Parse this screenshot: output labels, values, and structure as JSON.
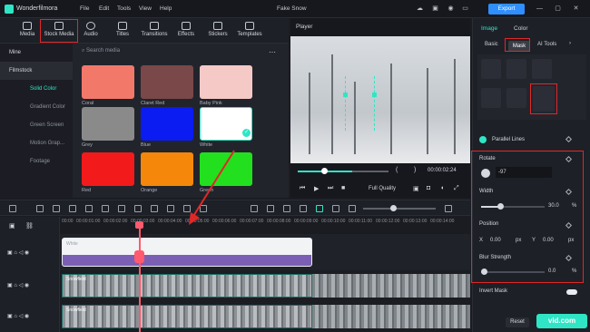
{
  "app": {
    "name": "Wonderfilmora",
    "project": "Fake Snow",
    "menu": [
      "File",
      "Edit",
      "Tools",
      "View",
      "Help"
    ],
    "export": "Export"
  },
  "media_tabs": [
    "Media",
    "Stock Media",
    "Audio",
    "Titles",
    "Transitions",
    "Effects",
    "Stickers",
    "Templates"
  ],
  "sidebar": {
    "items": [
      "Mine",
      "Filmstock",
      "Solid Color",
      "Gradient Color",
      "Green Screen",
      "Motion Grap...",
      "Footage"
    ]
  },
  "search": {
    "placeholder": "Search media"
  },
  "tiles": [
    {
      "label": "Coral",
      "color": "#f2796a"
    },
    {
      "label": "Claret Red",
      "color": "#7a4848"
    },
    {
      "label": "Baby Pink",
      "color": "#f5c9c6"
    },
    {
      "label": "Grey",
      "color": "#8a8a8a"
    },
    {
      "label": "Blue",
      "color": "#0a1cf2"
    },
    {
      "label": "White",
      "color": "#ffffff"
    },
    {
      "label": "Red",
      "color": "#f21a1a"
    },
    {
      "label": "Orange",
      "color": "#f5870a"
    },
    {
      "label": "Green",
      "color": "#22e01e"
    }
  ],
  "player": {
    "title": "Player",
    "timecode": "00:00:02:24",
    "quality": "Full Quality",
    "progress": 0.6
  },
  "right": {
    "tabs": [
      "Image",
      "Color"
    ],
    "subtabs": [
      "Basic",
      "Mask",
      "AI Tools"
    ],
    "mask_label": "Parallel Lines",
    "rotate": {
      "label": "Rotate",
      "value": "-97"
    },
    "width": {
      "label": "Width",
      "value": "30.0",
      "unit": "%",
      "level": 0.3
    },
    "position": {
      "label": "Position",
      "x_label": "X",
      "x": "0.00",
      "x_unit": "px",
      "y_label": "Y",
      "y": "0.00",
      "y_unit": "px"
    },
    "blur": {
      "label": "Blur Strength",
      "value": "0.0",
      "unit": "%",
      "level": 0.0
    },
    "invert": "Invert Mask",
    "reset": "Reset"
  },
  "ruler": [
    "00:00",
    "00:00:01:00",
    "00:00:02:00",
    "00:00:03:00",
    "00:00:04:00",
    "00:00:05:00",
    "00:00:06:00",
    "00:00:07:00",
    "00:00:08:00",
    "00:00:09:00",
    "00:00:10:00",
    "00:00:11:00",
    "00:00:12:00",
    "00:00:13:00",
    "00:00:14:00"
  ],
  "tracks": {
    "color_clip": "White",
    "video_clip": "Snowfield"
  },
  "watermark": "vid.com"
}
